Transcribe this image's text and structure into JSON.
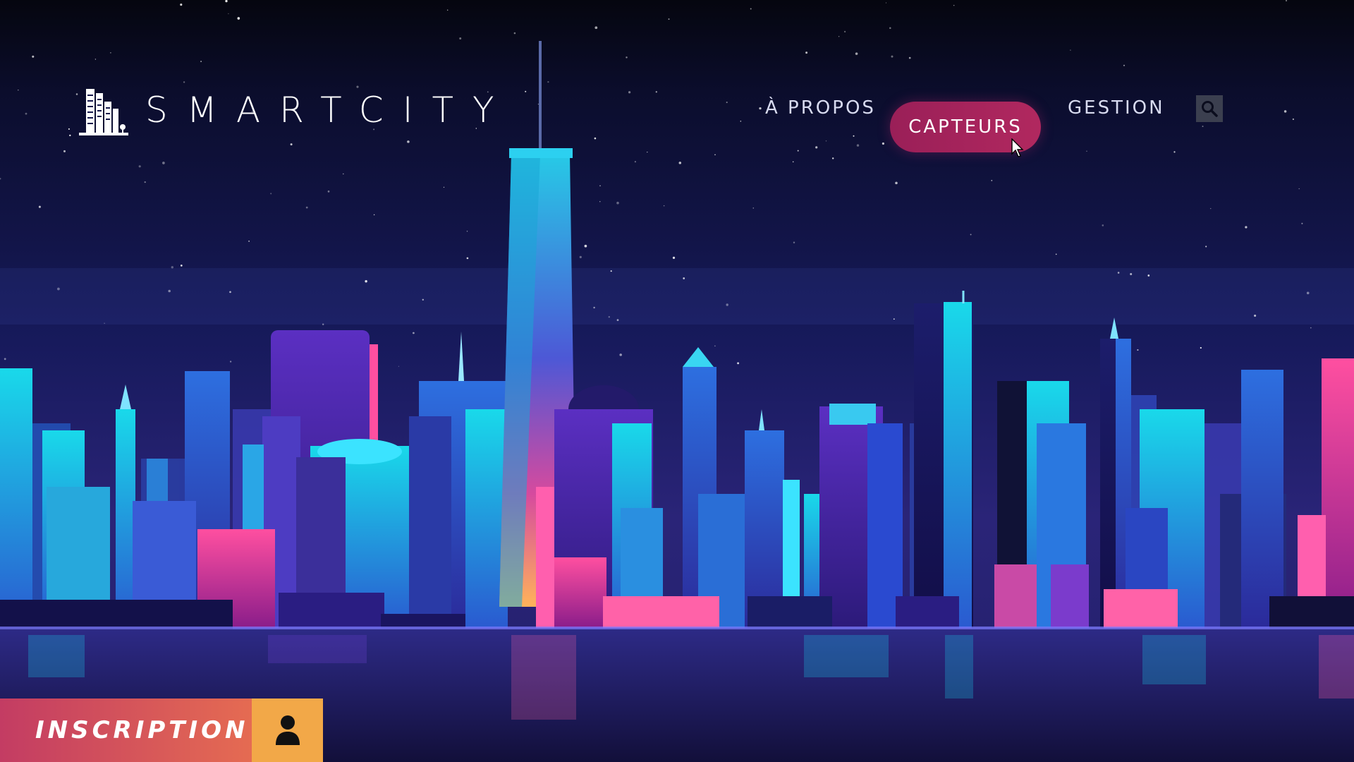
{
  "brand": {
    "name": "SMARTCITY",
    "icon": "city-buildings-icon"
  },
  "nav": {
    "items": [
      {
        "label": "À PROPOS",
        "active": false
      },
      {
        "label": "CAPTEURS",
        "active": true
      },
      {
        "label": "GESTION",
        "active": false
      }
    ],
    "search_icon": "search-icon",
    "active_color": "#a8245c"
  },
  "cta": {
    "label": "INSCRIPTION",
    "icon": "user-icon",
    "gradient": [
      "#c33c63",
      "#e56b52"
    ],
    "icon_bg": "#f2a848"
  },
  "hero": {
    "image": "neon city skyline illustration",
    "sky_color": "#0a0b24",
    "water_color": "#231d63"
  }
}
